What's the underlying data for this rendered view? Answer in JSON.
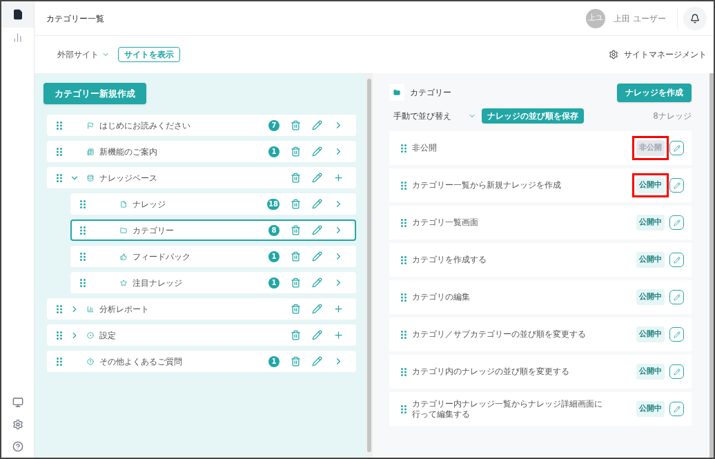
{
  "header": {
    "title": "カテゴリー一覧",
    "avatar": "上ユ",
    "user": "上田 ユーザー"
  },
  "toolbar": {
    "site_select": "外部サイト",
    "view_site": "サイトを表示",
    "management": "サイトマネージメント"
  },
  "tree": {
    "new_button": "カテゴリー新規作成",
    "items": [
      {
        "label": "はじめにお読みください",
        "count": "7",
        "selected": false
      },
      {
        "label": "新機能のご案内",
        "count": "1",
        "selected": false
      },
      {
        "label": "ナレッジベース",
        "expanded": true,
        "selected": false,
        "children": [
          {
            "label": "ナレッジ",
            "count": "18",
            "selected": false
          },
          {
            "label": "カテゴリー",
            "count": "8",
            "selected": true
          },
          {
            "label": "フィードバック",
            "count": "1",
            "selected": false
          },
          {
            "label": "注目ナレッジ",
            "count": "1",
            "selected": false
          }
        ]
      },
      {
        "label": "分析レポート",
        "expanded": false,
        "selected": false
      },
      {
        "label": "設定",
        "expanded": false,
        "selected": false
      },
      {
        "label": "その他よくあるご質問",
        "count": "1",
        "selected": false
      }
    ]
  },
  "detail": {
    "title": "カテゴリー",
    "create_button": "ナレッジを作成",
    "sort": "手動で並び替え",
    "save_order": "ナレッジの並び順を保存",
    "total": "8ナレッジ",
    "items": [
      {
        "title": [
          "非公開"
        ],
        "status": "非公開",
        "published": false,
        "highlighted": true
      },
      {
        "title": [
          "カテゴリー一覧から新規ナレッジを作成"
        ],
        "status": "公開中",
        "published": true,
        "highlighted": true
      },
      {
        "title": [
          "カテゴリ一覧画面"
        ],
        "status": "公開中",
        "published": true,
        "highlighted": false
      },
      {
        "title": [
          "カテゴリを作成する"
        ],
        "status": "公開中",
        "published": true,
        "highlighted": false
      },
      {
        "title": [
          "カテゴリの編集"
        ],
        "status": "公開中",
        "published": true,
        "highlighted": false
      },
      {
        "title": [
          "カテゴリ／サブカテゴリーの並び順を変更する"
        ],
        "status": "公開中",
        "published": true,
        "highlighted": false
      },
      {
        "title": [
          "カテゴリ内のナレッジの並び順を変更する"
        ],
        "status": "公開中",
        "published": true,
        "highlighted": false
      },
      {
        "title": [
          "カテゴリー内ナレッジ一覧からナレッジ詳細画面に",
          "行って編集する"
        ],
        "status": "公開中",
        "published": true,
        "highlighted": false
      }
    ]
  }
}
